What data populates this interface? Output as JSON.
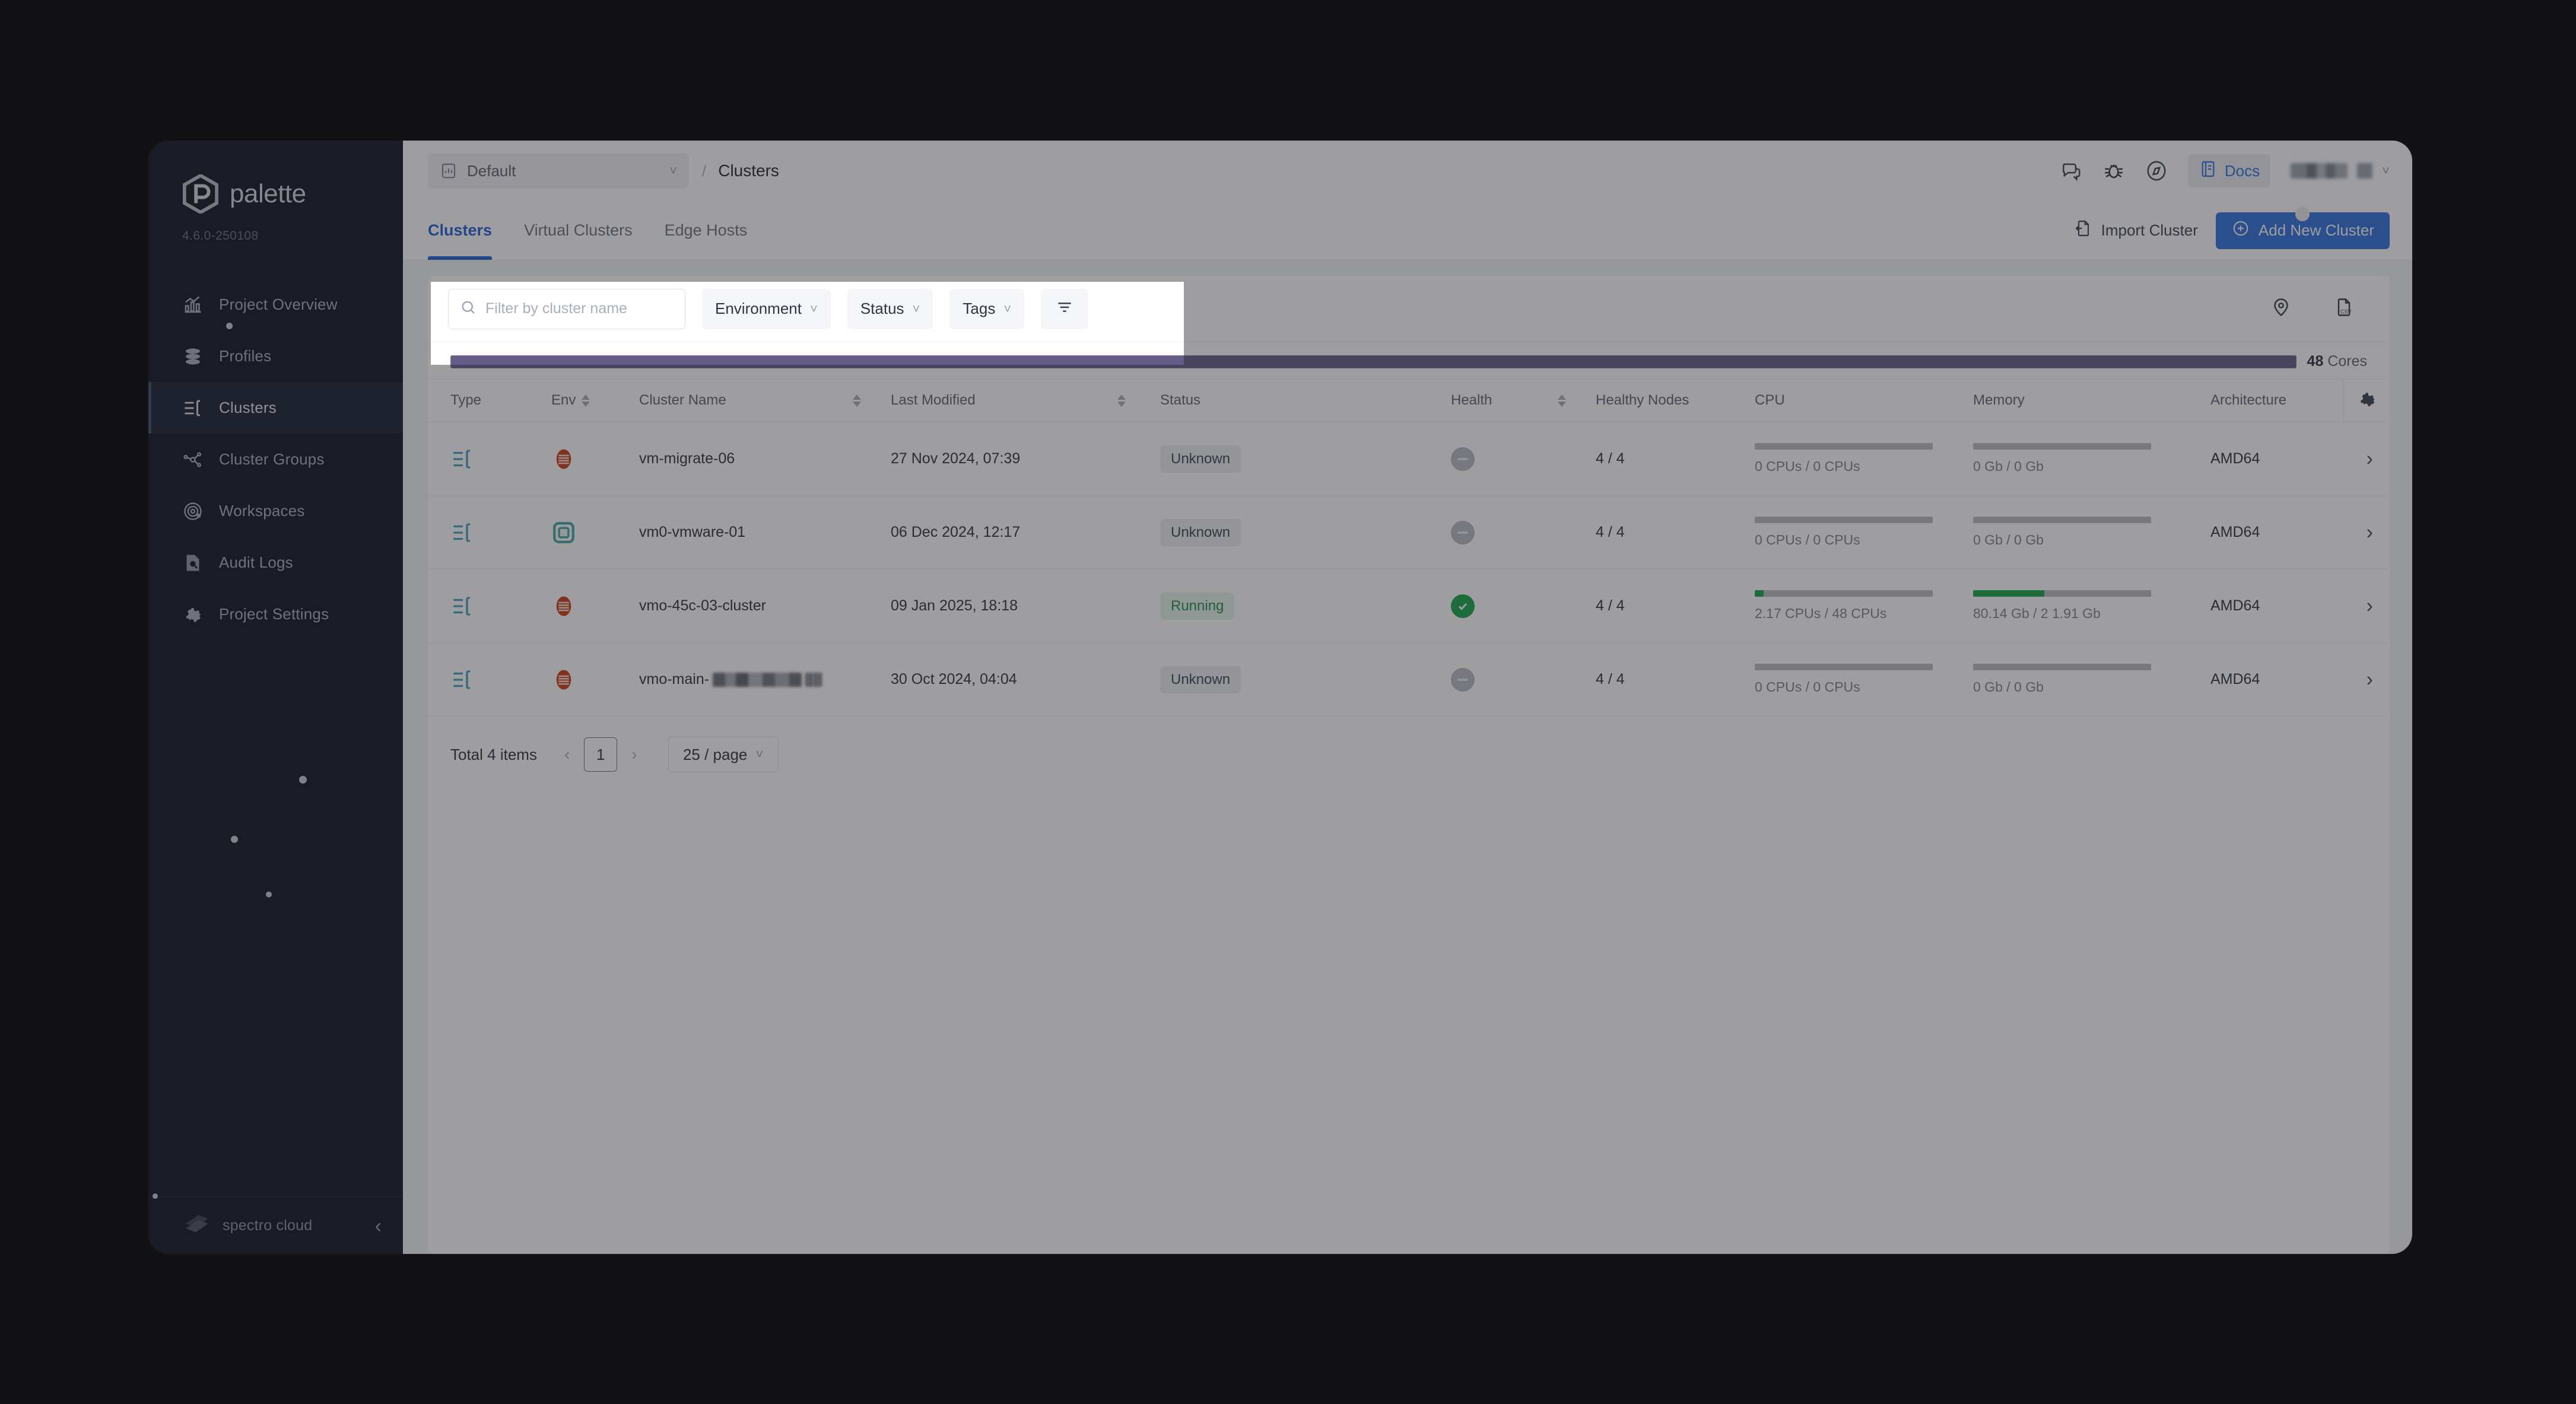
{
  "sidebar": {
    "logo_text": "palette",
    "version": "4.6.0-250108",
    "items": [
      {
        "label": "Project Overview",
        "icon": "chart-bar-icon"
      },
      {
        "label": "Profiles",
        "icon": "layers-icon"
      },
      {
        "label": "Clusters",
        "icon": "clusters-icon"
      },
      {
        "label": "Cluster Groups",
        "icon": "cluster-groups-icon"
      },
      {
        "label": "Workspaces",
        "icon": "workspaces-icon"
      },
      {
        "label": "Audit Logs",
        "icon": "audit-logs-icon"
      },
      {
        "label": "Project Settings",
        "icon": "gear-icon"
      }
    ],
    "active_item": "Clusters",
    "footer": {
      "brand": "spectro cloud",
      "collapse_icon": "chevron-left-icon"
    }
  },
  "topbar": {
    "project_name": "Default",
    "project_icon": "chart-icon",
    "breadcrumb_separator": "/",
    "breadcrumb_current": "Clusters",
    "icons": [
      "chat-icon",
      "bug-icon",
      "compass-icon"
    ],
    "docs_label": "Docs",
    "docs_icon": "book-icon",
    "user_name": "",
    "user_chevron": "chevron-down-icon"
  },
  "tabs": [
    {
      "label": "Clusters",
      "active": true
    },
    {
      "label": "Virtual Clusters",
      "active": false
    },
    {
      "label": "Edge Hosts",
      "active": false
    }
  ],
  "actions": {
    "import_label": "Import Cluster",
    "import_icon": "import-icon",
    "add_label": "Add New Cluster",
    "add_icon": "plus-circle-icon"
  },
  "filters": {
    "search_placeholder": "Filter by cluster name",
    "search_value": "",
    "search_icon": "search-icon",
    "dropdowns": [
      "Environment",
      "Status",
      "Tags"
    ],
    "filter_icon": "filter-lines-icon",
    "right_icons": [
      "map-pin-icon",
      "csv-export-icon"
    ]
  },
  "cores": {
    "count": "48",
    "unit": "Cores",
    "fill_percent": 100,
    "color": "#655b86"
  },
  "table": {
    "columns": [
      {
        "label": "Type",
        "sortable": false
      },
      {
        "label": "Env",
        "sortable": true
      },
      {
        "label": "Cluster Name",
        "sortable": true
      },
      {
        "label": "Last Modified",
        "sortable": true
      },
      {
        "label": "Status",
        "sortable": false
      },
      {
        "label": "Health",
        "sortable": true
      },
      {
        "label": "Healthy Nodes",
        "sortable": false
      },
      {
        "label": "CPU",
        "sortable": false
      },
      {
        "label": "Memory",
        "sortable": false
      },
      {
        "label": "Architecture",
        "sortable": false
      }
    ],
    "settings_icon": "gear-icon",
    "rows": [
      {
        "type_icon": "cluster-icon",
        "env_icon": "openstack-icon",
        "env_color": "#cc3a15",
        "name": "vm-migrate-06",
        "name_redacted": false,
        "last_modified": "27 Nov 2024, 07:39",
        "status": "Unknown",
        "status_kind": "unknown",
        "health": "unknown",
        "healthy_nodes": "4 / 4",
        "cpu_text": "0 CPUs / 0 CPUs",
        "cpu_percent": 0,
        "memory_text": "0 Gb / 0 Gb",
        "memory_percent": 0,
        "architecture": "AMD64"
      },
      {
        "type_icon": "cluster-icon",
        "env_icon": "vmware-icon",
        "env_color": "#3fa7a0",
        "name": "vm0-vmware-01",
        "name_redacted": false,
        "last_modified": "06 Dec 2024, 12:17",
        "status": "Unknown",
        "status_kind": "unknown",
        "health": "unknown",
        "healthy_nodes": "4 / 4",
        "cpu_text": "0 CPUs / 0 CPUs",
        "cpu_percent": 0,
        "memory_text": "0 Gb / 0 Gb",
        "memory_percent": 0,
        "architecture": "AMD64"
      },
      {
        "type_icon": "cluster-icon",
        "env_icon": "openstack-icon",
        "env_color": "#cc3a15",
        "name": "vmo-45c-03-cluster",
        "name_redacted": false,
        "last_modified": "09 Jan 2025, 18:18",
        "status": "Running",
        "status_kind": "running",
        "health": "ok",
        "healthy_nodes": "4 / 4",
        "cpu_text": "2.17 CPUs / 48 CPUs",
        "cpu_percent": 5,
        "memory_text": "80.14 Gb / 2 1.91 Gb",
        "memory_percent": 40,
        "architecture": "AMD64"
      },
      {
        "type_icon": "cluster-icon",
        "env_icon": "openstack-icon",
        "env_color": "#cc3a15",
        "name": "vmo-main-",
        "name_redacted": true,
        "last_modified": "30 Oct 2024, 04:04",
        "status": "Unknown",
        "status_kind": "unknown",
        "health": "unknown",
        "healthy_nodes": "4 / 4",
        "cpu_text": "0 CPUs / 0 CPUs",
        "cpu_percent": 0,
        "memory_text": "0 Gb / 0 Gb",
        "memory_percent": 0,
        "architecture": "AMD64"
      }
    ]
  },
  "pagination": {
    "total_text": "Total 4 items",
    "prev_icon": "chevron-left-icon",
    "next_icon": "chevron-right-icon",
    "current_page": "1",
    "page_size": "25 / page"
  }
}
